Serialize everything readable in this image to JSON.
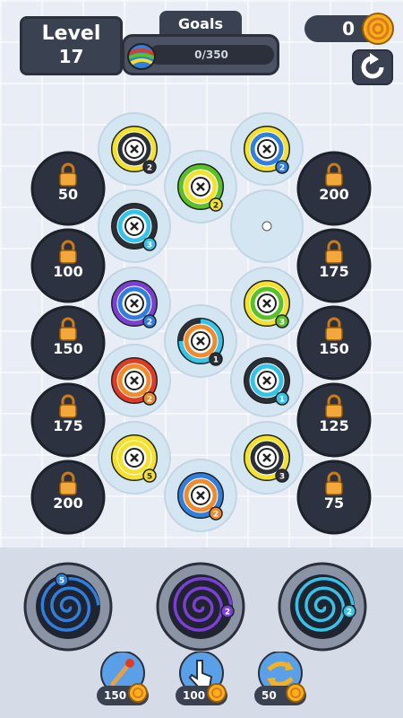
{
  "header": {
    "level_title": "Level",
    "level_number": "17",
    "goals_title": "Goals",
    "goals_progress": "0/350",
    "coins": "0"
  },
  "icons": {
    "goal": "rainbow-yarn-ball-icon",
    "coin": "coin-icon",
    "restart": "restart-icon",
    "lock": "padlock-icon",
    "booster_1": "matchstick-icon",
    "booster_2": "tap-hand-icon",
    "booster_3": "shuffle-icon"
  },
  "colors": {
    "yellow": "#f4e12d",
    "blue": "#2f7fe0",
    "green": "#58c12a",
    "black": "#2b2f38",
    "cyan": "#36c3e8",
    "purple": "#7b3fd6",
    "orange": "#f08a2a",
    "red": "#e23a24",
    "locked": "#2d3240"
  },
  "locked_slots": [
    {
      "cost": "50"
    },
    {
      "cost": "100"
    },
    {
      "cost": "150"
    },
    {
      "cost": "175"
    },
    {
      "cost": "200"
    },
    {
      "cost": "200"
    },
    {
      "cost": "175"
    },
    {
      "cost": "150"
    },
    {
      "cost": "125"
    },
    {
      "cost": "75"
    }
  ],
  "spools": [
    {
      "colors": [
        "yellow",
        "black"
      ],
      "count": "2"
    },
    {
      "colors": [
        "yellow",
        "blue"
      ],
      "count": "2"
    },
    {
      "colors": [
        "green",
        "yellow"
      ],
      "count": "2"
    },
    {
      "colors": [
        "black",
        "cyan"
      ],
      "count": "3"
    },
    {
      "colors": [
        "purple",
        "blue"
      ],
      "count": "2"
    },
    {
      "colors": [
        "yellow",
        "green"
      ],
      "count": "3"
    },
    {
      "colors": [
        "cyan",
        "orange",
        "black"
      ],
      "count": "1"
    },
    {
      "colors": [
        "red",
        "orange"
      ],
      "count": "2"
    },
    {
      "colors": [
        "black",
        "cyan"
      ],
      "count": "1"
    },
    {
      "colors": [
        "yellow",
        "yellow"
      ],
      "count": "5"
    },
    {
      "colors": [
        "yellow",
        "black"
      ],
      "count": "3"
    },
    {
      "colors": [
        "blue",
        "orange"
      ],
      "count": "2"
    }
  ],
  "collectors": [
    {
      "color": "blue",
      "count": "5"
    },
    {
      "color": "purple",
      "count": "2"
    },
    {
      "color": "cyan",
      "count": "2"
    }
  ],
  "boosters": [
    {
      "price": "150"
    },
    {
      "price": "100"
    },
    {
      "price": "50"
    }
  ]
}
